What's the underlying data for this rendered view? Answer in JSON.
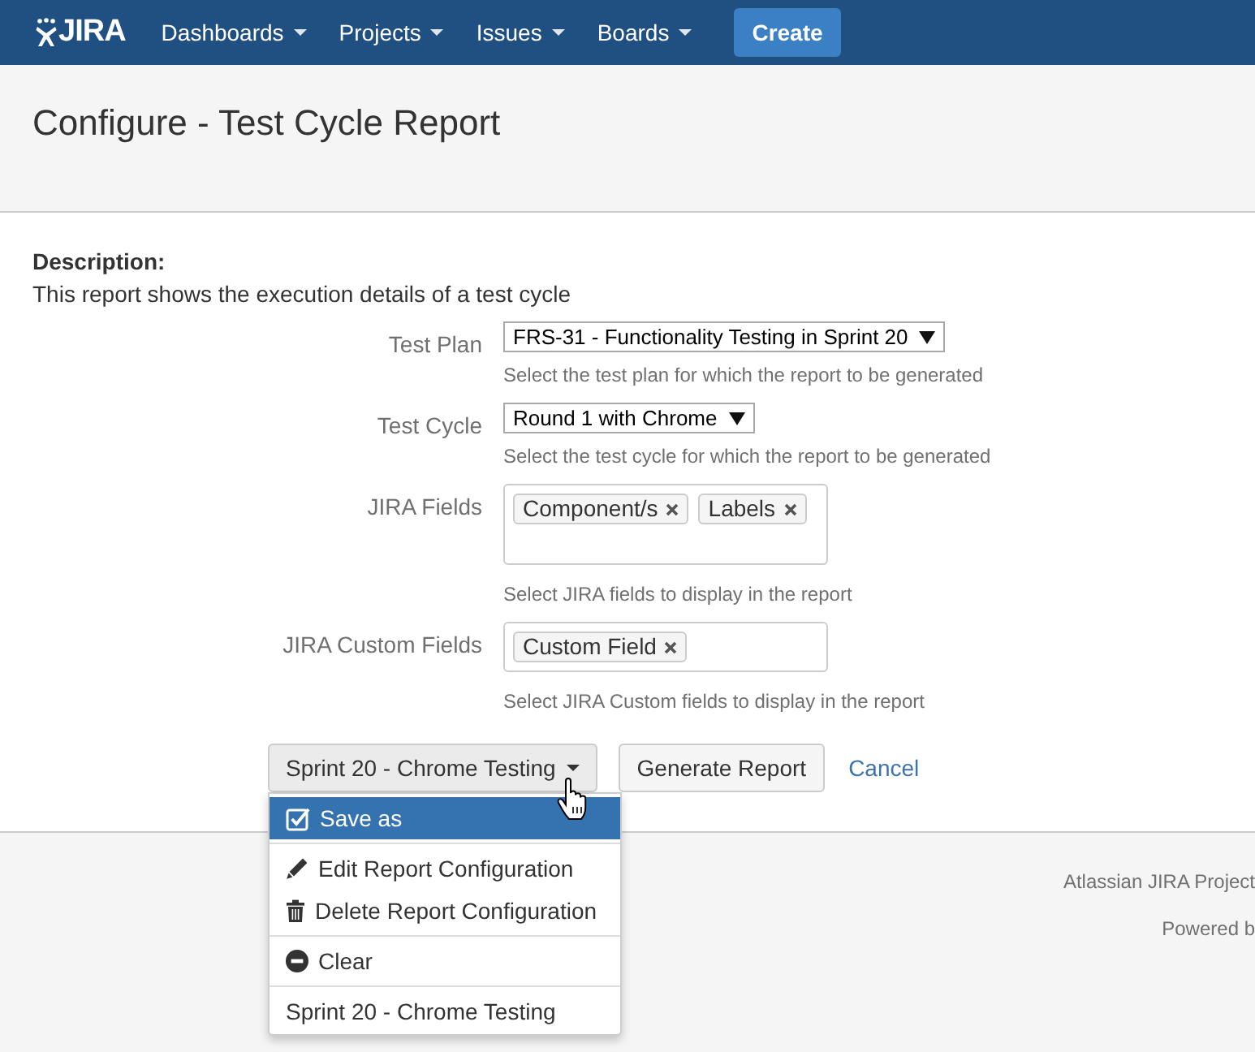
{
  "header": {
    "logo_text": "JIRA",
    "nav": [
      {
        "label": "Dashboards"
      },
      {
        "label": "Projects"
      },
      {
        "label": "Issues"
      },
      {
        "label": "Boards"
      }
    ],
    "create_button": "Create"
  },
  "page_header": {
    "title": "Configure - Test Cycle Report"
  },
  "description": {
    "heading": "Description:",
    "text": "This report shows the execution details of a test cycle"
  },
  "form": {
    "fields": [
      {
        "kind": "select",
        "label": "Test Plan",
        "value": "FRS-31 - Functionality Testing in Sprint 20",
        "help": "Select the test plan for which the report to be generated"
      },
      {
        "kind": "select",
        "label": "Test Cycle",
        "value": "Round 1 with Chrome",
        "help": "Select the test cycle for which the report to be generated"
      },
      {
        "kind": "multi_select",
        "label": "JIRA Fields",
        "tags": [
          "Component/s",
          "Labels"
        ],
        "help": "Select JIRA fields to display in the report"
      },
      {
        "kind": "multi_select",
        "label": "JIRA Custom Fields",
        "tags": [
          "Custom Field"
        ],
        "help": "Select JIRA Custom fields to display in the report"
      }
    ]
  },
  "actions": {
    "config_dropdown": {
      "label": "Sprint 20 - Chrome Testing",
      "expanded": true,
      "menu_groups": [
        {
          "items": [
            {
              "kind": "save",
              "label": "Save as",
              "selected": true
            }
          ]
        },
        {
          "items": [
            {
              "kind": "edit",
              "label": "Edit Report Configuration",
              "selected": false
            },
            {
              "kind": "delete",
              "label": "Delete Report Configuration",
              "selected": false
            }
          ]
        },
        {
          "items": [
            {
              "kind": "clear",
              "label": "Clear",
              "selected": false
            }
          ]
        },
        {
          "items": [
            {
              "kind": "saved_config",
              "label": "Sprint 20 - Chrome Testing",
              "selected": false
            }
          ]
        }
      ]
    },
    "generate_button": "Generate Report",
    "cancel_link": "Cancel"
  },
  "footer": {
    "lines": [
      "Atlassian JIRA Project",
      "Powered b"
    ]
  }
}
